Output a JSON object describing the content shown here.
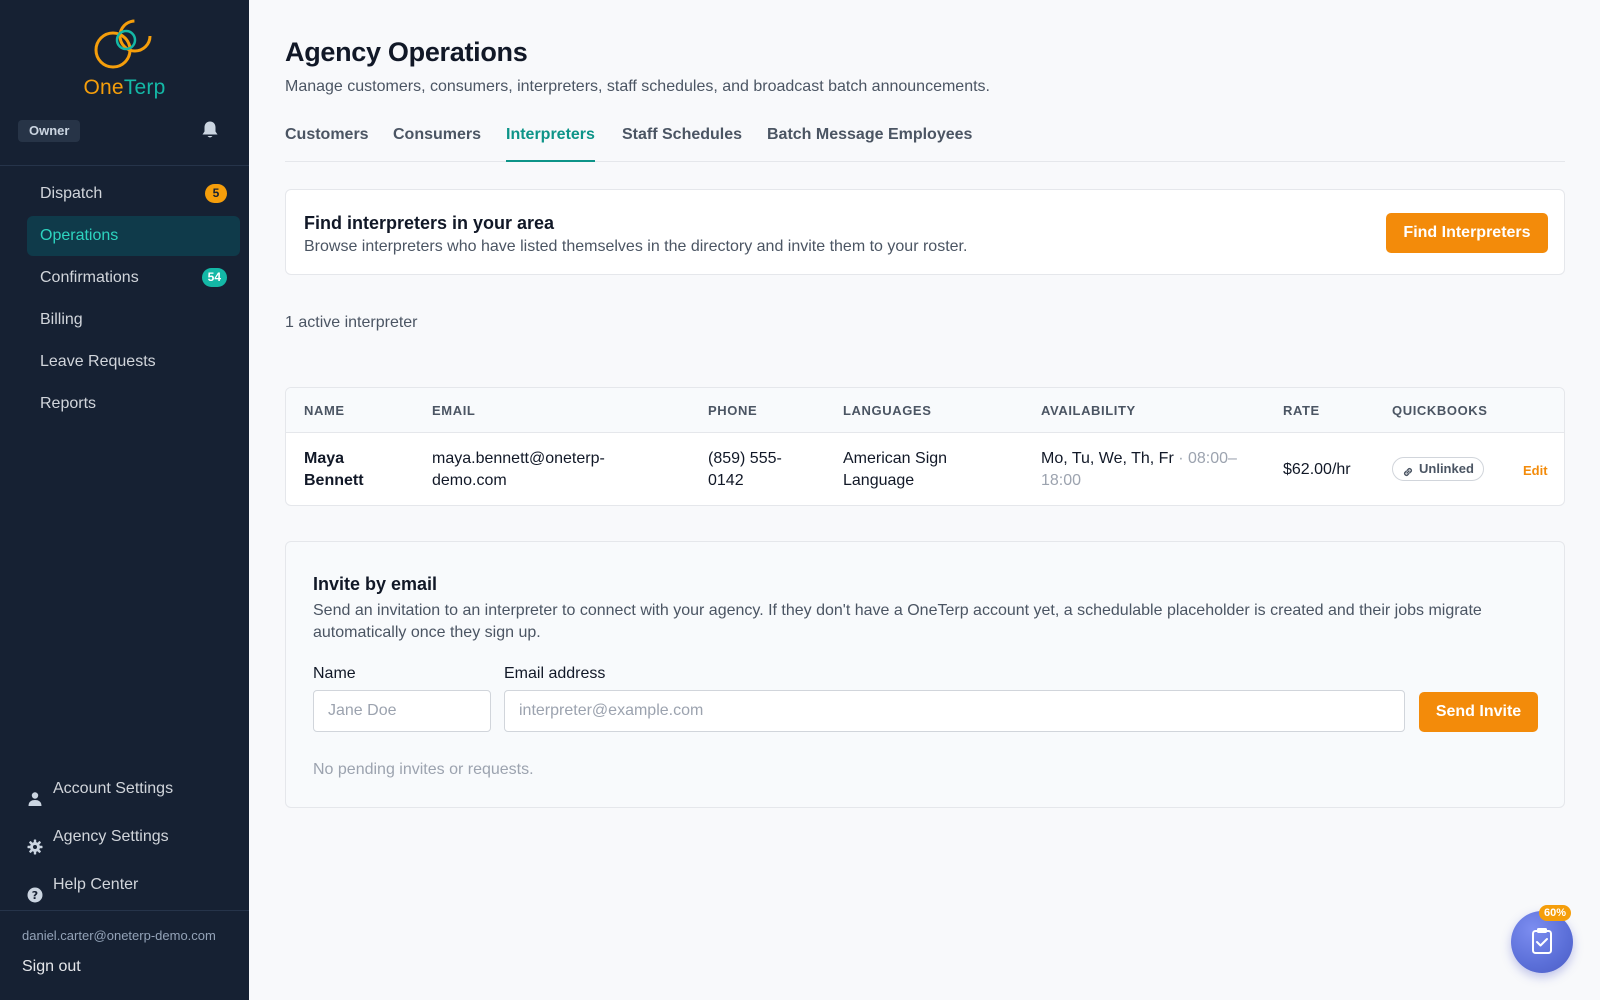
{
  "sidebar": {
    "logo": {
      "part1": "One",
      "part2": "Terp"
    },
    "role_badge": "Owner",
    "nav": [
      {
        "label": "Dispatch",
        "badge": "5"
      },
      {
        "label": "Operations",
        "badge": ""
      },
      {
        "label": "Confirmations",
        "badge": "54"
      },
      {
        "label": "Billing",
        "badge": ""
      },
      {
        "label": "Leave Requests",
        "badge": ""
      },
      {
        "label": "Reports",
        "badge": ""
      }
    ],
    "bottom": [
      {
        "label": "Account Settings",
        "icon": "user-icon"
      },
      {
        "label": "Agency Settings",
        "icon": "gear-icon"
      },
      {
        "label": "Help Center",
        "icon": "help-icon"
      }
    ],
    "user_email": "daniel.carter@oneterp-demo.com",
    "sign_out": "Sign out"
  },
  "header": {
    "title": "Agency Operations",
    "subtitle": "Manage customers, consumers, interpreters, staff schedules, and broadcast batch announcements."
  },
  "tabs": [
    {
      "label": "Customers"
    },
    {
      "label": "Consumers"
    },
    {
      "label": "Interpreters",
      "active": true
    },
    {
      "label": "Staff Schedules"
    },
    {
      "label": "Batch Message Employees"
    }
  ],
  "find_card": {
    "title": "Find interpreters in your area",
    "description": "Browse interpreters who have listed themselves in the directory and invite them to your roster.",
    "button": "Find Interpreters"
  },
  "active_count": "1 active interpreter",
  "table": {
    "columns": [
      "NAME",
      "EMAIL",
      "PHONE",
      "LANGUAGES",
      "AVAILABILITY",
      "RATE",
      "QUICKBOOKS"
    ],
    "rows": [
      {
        "name_first": "Maya",
        "name_last": "Bennett",
        "email_line1": "maya.bennett@oneterp-",
        "email_line2": "demo.com",
        "phone_line1": "(859) 555-",
        "phone_line2": "0142",
        "languages_line1": "American Sign",
        "languages_line2": "Language",
        "availability_days": "Mo, Tu, We, Th, Fr",
        "availability_sep": " · ",
        "availability_time1": "08:00–",
        "availability_time2": "18:00",
        "rate": "$62.00/hr",
        "quickbooks": "Unlinked",
        "action": "Edit"
      }
    ]
  },
  "invite": {
    "title": "Invite by email",
    "description": "Send an invitation to an interpreter to connect with your agency. If they don't have a OneTerp account yet, a schedulable placeholder is created and their jobs migrate automatically once they sign up.",
    "name_label": "Name",
    "name_placeholder": "Jane Doe",
    "email_label": "Email address",
    "email_placeholder": "interpreter@example.com",
    "button": "Send Invite",
    "pending_text": "No pending invites or requests."
  },
  "fab": {
    "badge": "60%",
    "icon": "clipboard-check-icon"
  },
  "colors": {
    "sidebar_bg": "#162133",
    "accent_teal": "#0d9488",
    "accent_orange": "#f38b0a"
  }
}
